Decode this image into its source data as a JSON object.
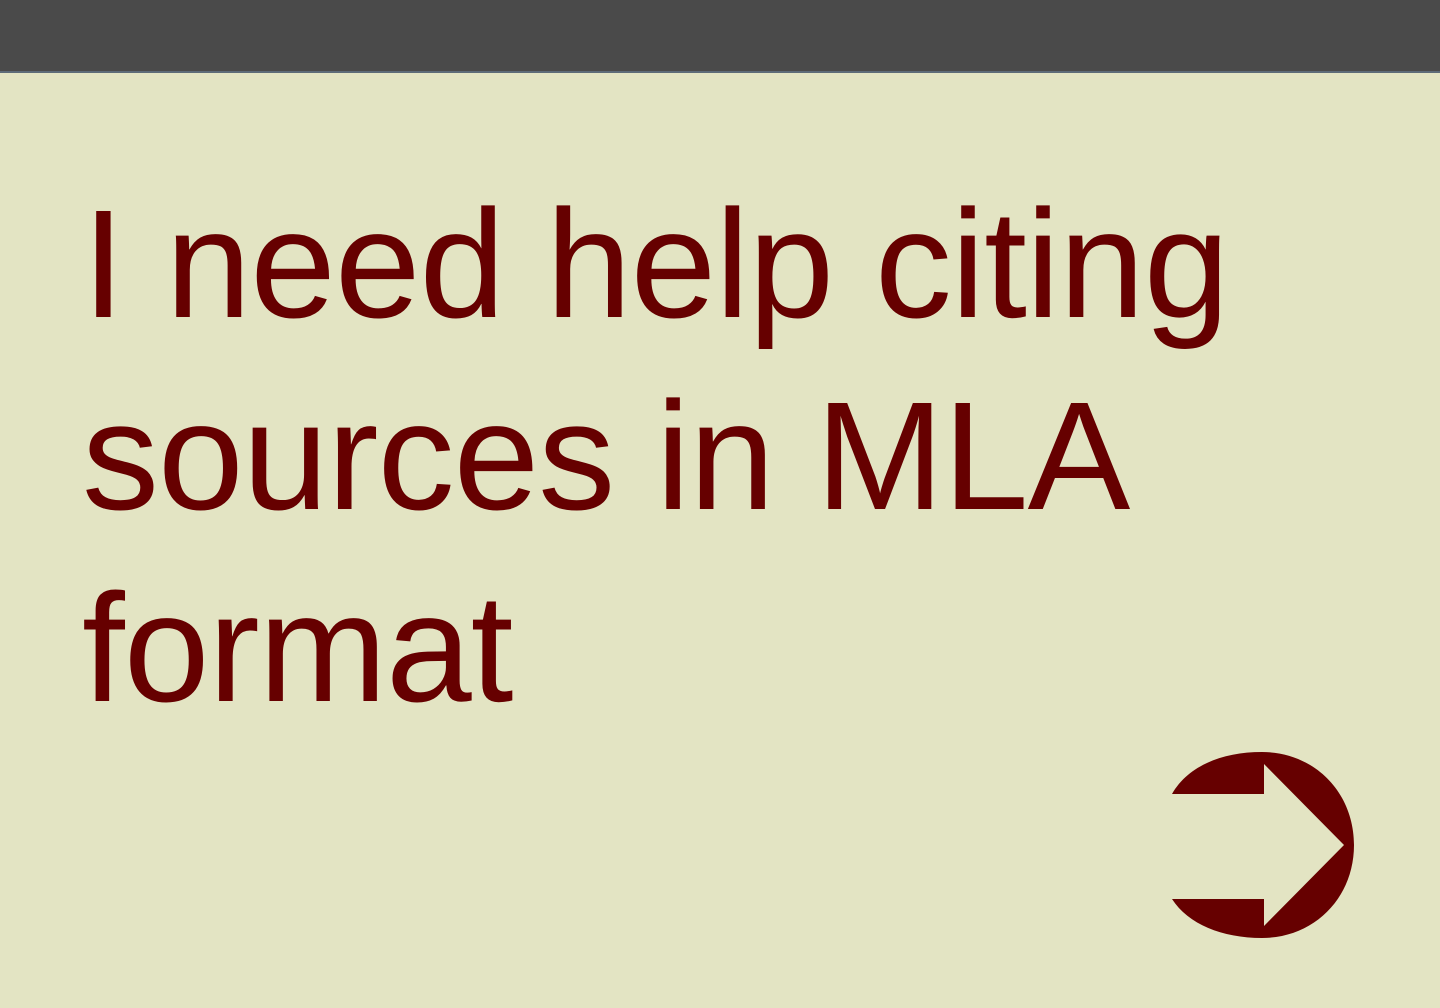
{
  "header": {
    "bar_color": "#4a4a4a"
  },
  "main": {
    "prompt": {
      "lead": "I need help",
      "line1_end": "citing",
      "line2": "sources in MLA",
      "line3": "format"
    },
    "text_color": "#660000",
    "background_color": "#e3e4c3"
  },
  "navigation": {
    "next": {
      "icon": "arrow-right-icon",
      "color": "#660000"
    }
  }
}
